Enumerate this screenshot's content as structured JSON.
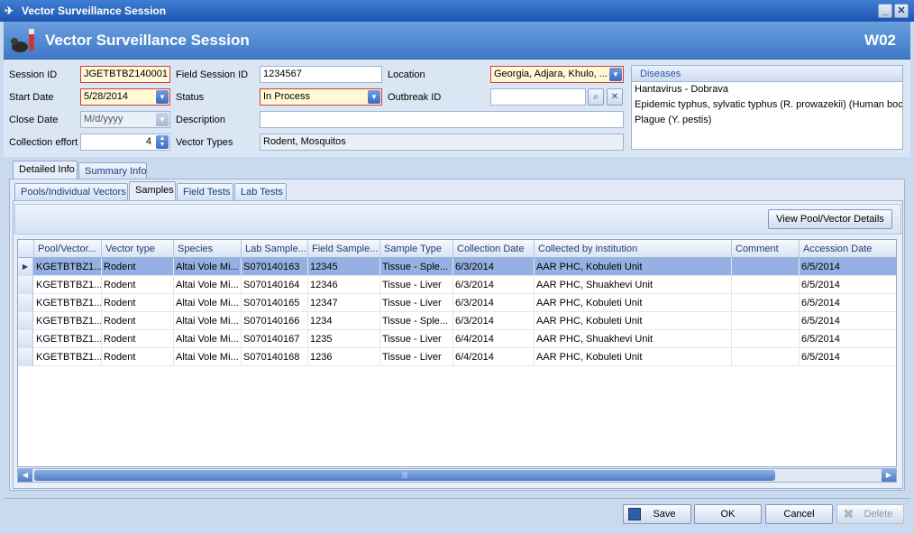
{
  "window": {
    "title": "Vector Surveillance Session"
  },
  "header": {
    "title": "Vector Surveillance Session",
    "code": "W02"
  },
  "form": {
    "session_id_label": "Session ID",
    "session_id": "JGETBTBZ140001",
    "field_session_id_label": "Field Session ID",
    "field_session_id": "1234567",
    "location_label": "Location",
    "location": "Georgia, Adjara, Khulo, ...",
    "start_date_label": "Start Date",
    "start_date": "5/28/2014",
    "status_label": "Status",
    "status": "In Process",
    "outbreak_id_label": "Outbreak ID",
    "outbreak_id": "",
    "close_date_label": "Close Date",
    "close_date_placeholder": "M/d/yyyy",
    "description_label": "Description",
    "description": "",
    "collection_effort_label": "Collection effort",
    "collection_effort": "4",
    "vector_types_label": "Vector Types",
    "vector_types": "Rodent, Mosquitos"
  },
  "diseases": {
    "header": "Diseases",
    "items": [
      "Hantavirus - Dobrava",
      "Epidemic typhus, sylvatic typhus (R. prowazekii) (Human boc",
      "Plague (Y. pestis)"
    ]
  },
  "tabs_top": [
    {
      "label": "Detailed Info",
      "active": true
    },
    {
      "label": "Summary Info",
      "active": false
    }
  ],
  "tabs_sub": [
    {
      "label": "Pools/Individual Vectors",
      "active": false
    },
    {
      "label": "Samples",
      "active": true
    },
    {
      "label": "Field Tests",
      "active": false
    },
    {
      "label": "Lab Tests",
      "active": false
    }
  ],
  "toolbar": {
    "view_details_label": "View Pool/Vector Details"
  },
  "grid": {
    "columns": [
      "Pool/Vector...",
      "Vector type",
      "Species",
      "Lab Sample...",
      "Field Sample...",
      "Sample Type",
      "Collection Date",
      "Collected by institution",
      "Comment",
      "Accession Date"
    ],
    "rows": [
      [
        "KGETBTBZ1...",
        "Rodent",
        "Altai Vole Mi...",
        "S070140163",
        "12345",
        "Tissue - Sple...",
        "6/3/2014",
        "AAR PHC, Kobuleti Unit",
        "",
        "6/5/2014"
      ],
      [
        "KGETBTBZ1...",
        "Rodent",
        "Altai Vole Mi...",
        "S070140164",
        "12346",
        "Tissue - Liver",
        "6/3/2014",
        "AAR PHC, Shuakhevi Unit",
        "",
        "6/5/2014"
      ],
      [
        "KGETBTBZ1...",
        "Rodent",
        "Altai Vole Mi...",
        "S070140165",
        "12347",
        "Tissue - Liver",
        "6/3/2014",
        "AAR PHC, Kobuleti Unit",
        "",
        "6/5/2014"
      ],
      [
        "KGETBTBZ1...",
        "Rodent",
        "Altai Vole Mi...",
        "S070140166",
        "1234",
        "Tissue - Sple...",
        "6/3/2014",
        "AAR PHC, Kobuleti Unit",
        "",
        "6/5/2014"
      ],
      [
        "KGETBTBZ1...",
        "Rodent",
        "Altai Vole Mi...",
        "S070140167",
        "1235",
        "Tissue - Liver",
        "6/4/2014",
        "AAR PHC, Shuakhevi Unit",
        "",
        "6/5/2014"
      ],
      [
        "KGETBTBZ1...",
        "Rodent",
        "Altai Vole Mi...",
        "S070140168",
        "1236",
        "Tissue - Liver",
        "6/4/2014",
        "AAR PHC, Kobuleti Unit",
        "",
        "6/5/2014"
      ]
    ],
    "selected_row": 0
  },
  "footer": {
    "save_label": "Save",
    "ok_label": "OK",
    "cancel_label": "Cancel",
    "delete_label": "Delete"
  },
  "colors": {
    "accent": "#3e78c7",
    "required_border": "#d23b3b",
    "required_bg": "#fff9d6",
    "selection": "#95b1e3"
  }
}
